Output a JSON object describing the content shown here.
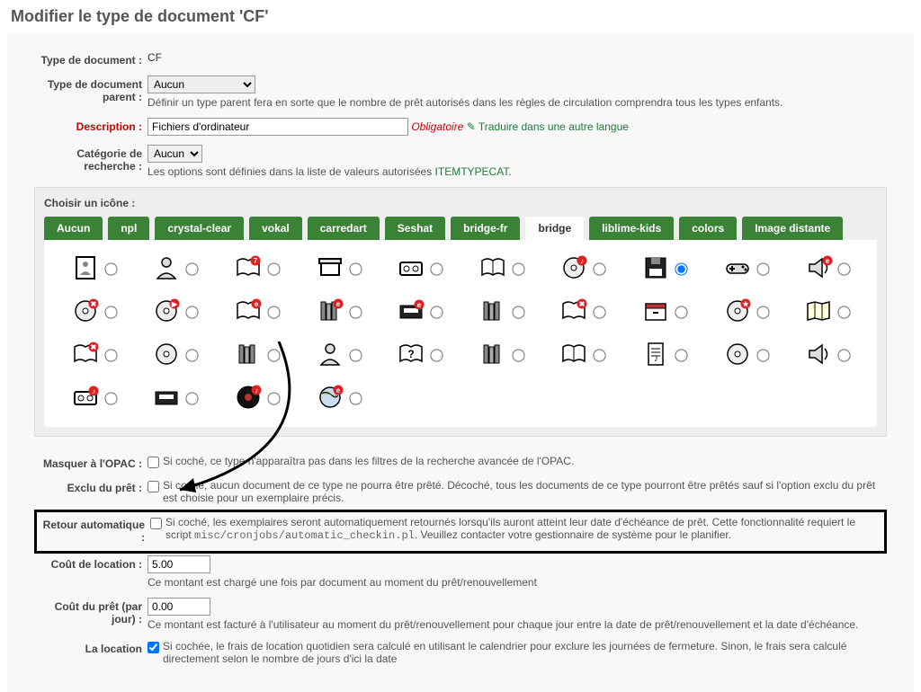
{
  "page": {
    "title": "Modifier le type de document 'CF'"
  },
  "form": {
    "type_doc_label": "Type de document :",
    "type_doc_value": "CF",
    "type_parent_label": "Type de document parent :",
    "type_parent_value": "Aucun",
    "type_parent_help": "Définir un type parent fera en sorte que le nombre de prêt autorisés dans les règles de circulation comprendra tous les types enfants.",
    "description_label": "Description :",
    "description_value": "Fichiers d'ordinateur",
    "obligatoire": "Obligatoire",
    "traduire": "Traduire dans une autre langue",
    "categorie_label": "Catégorie de recherche :",
    "categorie_value": "Aucun",
    "categorie_help": "Les options sont définies dans la liste de valeurs autorisées",
    "categorie_link": "ITEMTYPECAT",
    "icon_label": "Choisir un icône :",
    "tabs": [
      "Aucun",
      "npl",
      "crystal-clear",
      "vokal",
      "carredart",
      "Seshat",
      "bridge-fr",
      "bridge",
      "liblime-kids",
      "colors",
      "Image distante"
    ],
    "active_tab": "bridge",
    "masquer_label": "Masquer à l'OPAC :",
    "masquer_help": "Si coché, ce type n'apparaîtra pas dans les filtres de la recherche avancée de l'OPAC.",
    "exclu_label": "Exclu du prêt :",
    "exclu_help": "Si coché, aucun document de ce type ne pourra être prêté. Décoché, tous les documents de ce type pourront être prêtés sauf si l'option exclu du prêt est choisie pour un exemplaire précis.",
    "retour_label": "Retour automatique :",
    "retour_help_1": "Si coché, les exemplaires seront automatiquement retournés lorsqu'ils auront atteint leur date d'échéance de prêt. Cette fonctionnalité requiert le script",
    "retour_code": "misc/cronjobs/automatic_checkin.pl",
    "retour_help_2": ". Veuillez contacter votre gestionnaire de système pour le planifier.",
    "cout_loc_label": "Coût de location :",
    "cout_loc_value": "5.00",
    "cout_loc_help": "Ce montant est chargé une fois par document au moment du prêt/renouvellement",
    "cout_pret_label": "Coût du prêt (par jour) :",
    "cout_pret_value": "0.00",
    "cout_pret_help": "Ce montant est facturé à l'utilisateur au moment du prêt/renouvellement pour chaque jour entre la date de prêt/renouvellement et la date d'échéance.",
    "la_location_label": "La location",
    "la_location_help": "Si cochée, le frais de location quotidien sera calculé en utilisant le calendrier pour exclure les journées de fermeture. Sinon, le frais sera calculé directement selon le nombre de jours d'ici la date",
    "la_location_checked": true,
    "selected_icon_index": 7
  },
  "icons": [
    "portrait",
    "bust",
    "book-7",
    "box",
    "cassette",
    "open-book",
    "cd-music",
    "floppy",
    "gamepad",
    "speaker-e",
    "cd-cancel",
    "cd-play",
    "book-e",
    "books-stack-e",
    "vhs-e",
    "books-stack",
    "book-x",
    "drawer",
    "cd-star",
    "map",
    "book-x2",
    "cd",
    "books-stack2",
    "bust2",
    "book-q",
    "books-stack3",
    "book2",
    "sheet-music",
    "cd2",
    "speaker",
    "cassette-e",
    "vhs",
    "record-e",
    "globe-e"
  ]
}
